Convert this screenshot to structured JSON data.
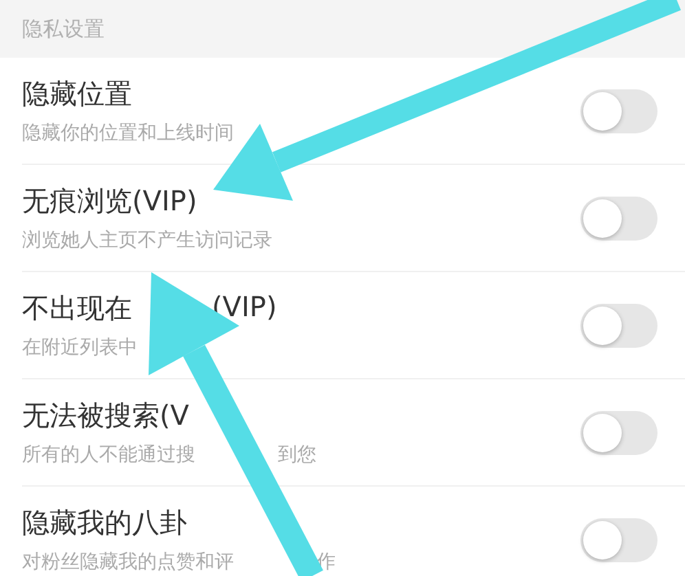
{
  "section_title": "隐私设置",
  "settings": [
    {
      "title": "隐藏位置",
      "description": "隐藏你的位置和上线时间",
      "on": false
    },
    {
      "title": "无痕浏览(VIP)",
      "description": "浏览她人主页不产生访问记录",
      "on": false
    },
    {
      "title": "不出现在",
      "title_continued": "(VIP)",
      "description": "在附近列表中",
      "on": false
    },
    {
      "title": "无法被搜索(V",
      "description": "所有的人不能通过搜",
      "description_continued": "到您",
      "on": false
    },
    {
      "title": "隐藏我的八卦",
      "description": "对粉丝隐藏我的点赞和评",
      "description_continued": "作",
      "on": false
    }
  ]
}
